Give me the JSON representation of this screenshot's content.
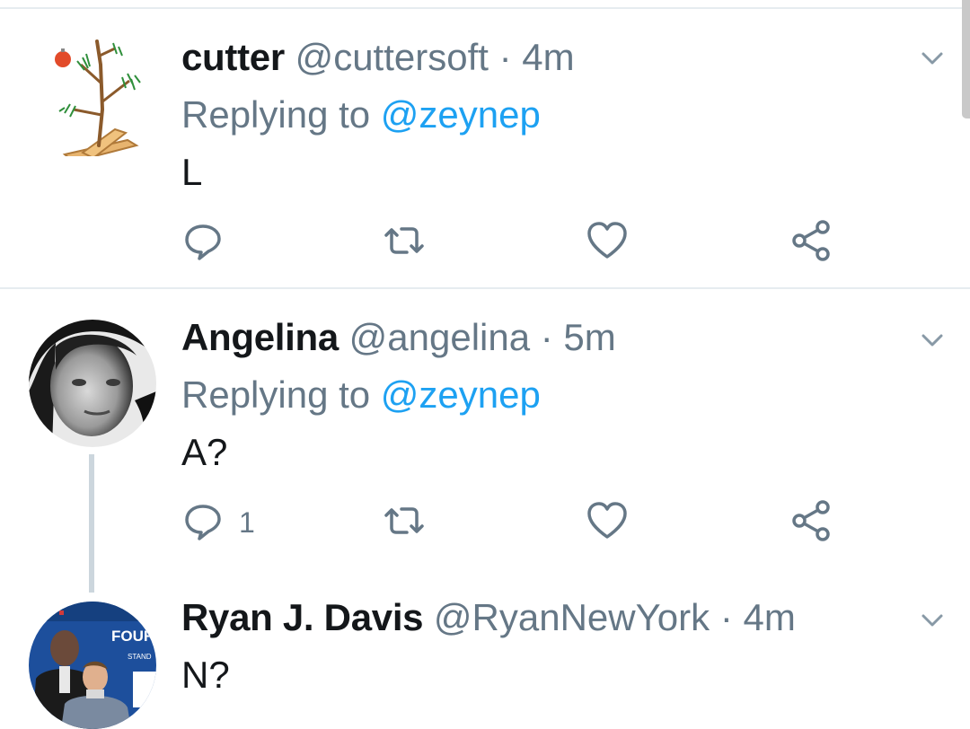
{
  "tweets": [
    {
      "name": "cutter",
      "handle": "@cuttersoft",
      "separator": "·",
      "time": "4m",
      "replying_prefix": "Replying to",
      "replying_to": "@zeynep",
      "text": "L",
      "reply_count": ""
    },
    {
      "name": "Angelina",
      "handle": "@angelina",
      "separator": "·",
      "time": "5m",
      "replying_prefix": "Replying to",
      "replying_to": "@zeynep",
      "text": "A?",
      "reply_count": "1"
    },
    {
      "name": "Ryan J. Davis",
      "handle": "@RyanNewYork",
      "separator": "·",
      "time": "4m",
      "text": "N?",
      "avatar_sign_text": "FOUR",
      "avatar_sign_subtext": "STAND"
    }
  ],
  "icons": {
    "reply": "reply-icon",
    "retweet": "retweet-icon",
    "like": "heart-icon",
    "share": "share-icon",
    "more": "chevron-down-icon"
  },
  "colors": {
    "name": "#14171a",
    "secondary": "#657786",
    "link": "#1da1f2",
    "divider": "#e6ecf0",
    "thread_line": "#ccd6dd"
  }
}
